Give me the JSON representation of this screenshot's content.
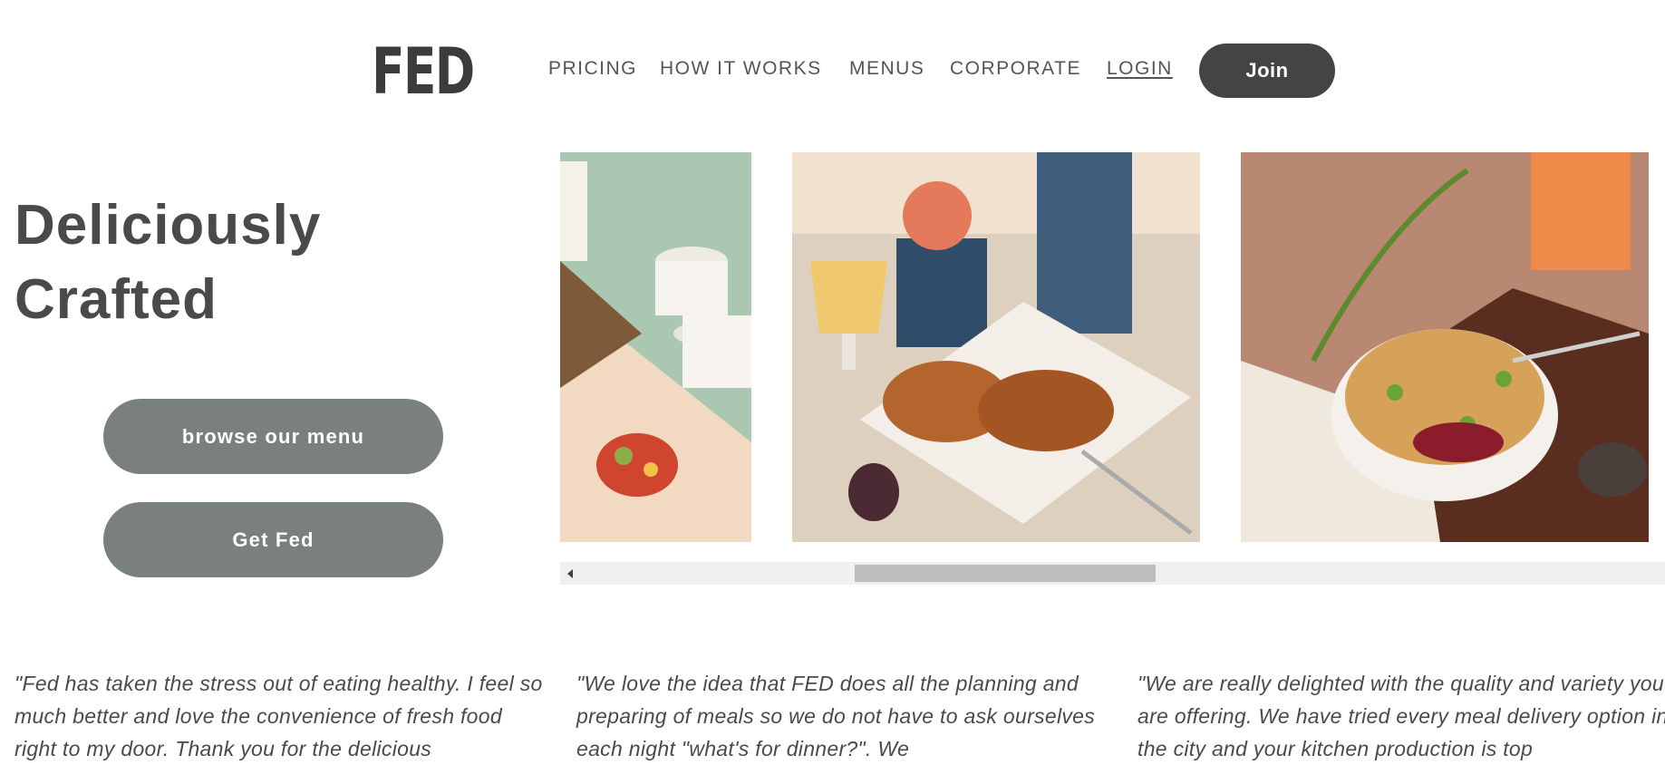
{
  "header": {
    "logo": "FED",
    "nav": [
      {
        "label": "PRICING"
      },
      {
        "label": "HOW IT WORKS"
      },
      {
        "label": "MENUS"
      },
      {
        "label": "CORPORATE"
      },
      {
        "label": "LOGIN"
      }
    ],
    "join_label": "Join"
  },
  "hero": {
    "title_line1": "Deliciously",
    "title_line2": "Crafted",
    "browse_label": "browse our menu",
    "getfed_label": "Get Fed"
  },
  "gallery": {
    "scroll_position": 0.35
  },
  "testimonials": [
    {
      "text": "\"Fed has taken the stress out of eating healthy. I feel so much better and love the convenience of fresh food right to my door. Thank you for the delicious"
    },
    {
      "text": "\"We love the idea that FED does all the planning and preparing of meals so we do not have to ask ourselves each night \"what's for dinner?\". We"
    },
    {
      "text": "\"We are really delighted with the quality and variety you are offering. We have tried every meal delivery option in the city and your kitchen production is top"
    }
  ],
  "colors": {
    "join_bg": "#444444",
    "hero_btn_bg": "#7a807f",
    "text": "#4a4a4a"
  }
}
